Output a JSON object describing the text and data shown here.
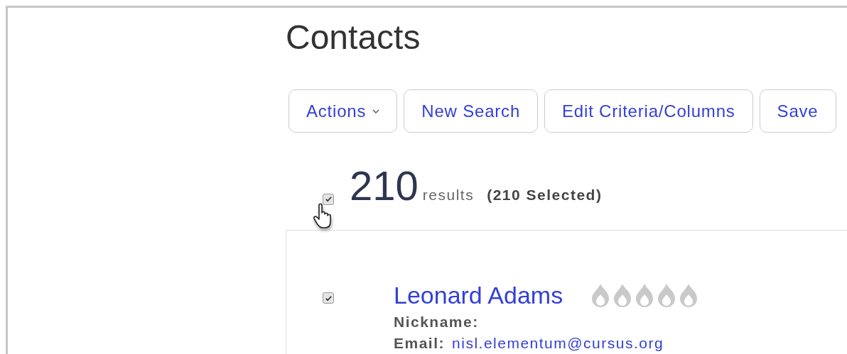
{
  "title": "Contacts",
  "toolbar": [
    {
      "label": "Actions",
      "kind": "dropdown"
    },
    {
      "label": "New Search",
      "kind": "button"
    },
    {
      "label": "Edit Criteria/Columns",
      "kind": "button"
    },
    {
      "label": "Save",
      "kind": "button"
    }
  ],
  "results": {
    "count": "210",
    "label": "results",
    "selected_text": "(210 Selected)",
    "checked": true
  },
  "contacts": [
    {
      "name": "Leonard Adams",
      "checked": true,
      "fields": [
        {
          "label": "Nickname:"
        },
        {
          "label": "Email:",
          "value": "nisl.elementum@cursus.org",
          "kind": "link"
        }
      ]
    }
  ]
}
